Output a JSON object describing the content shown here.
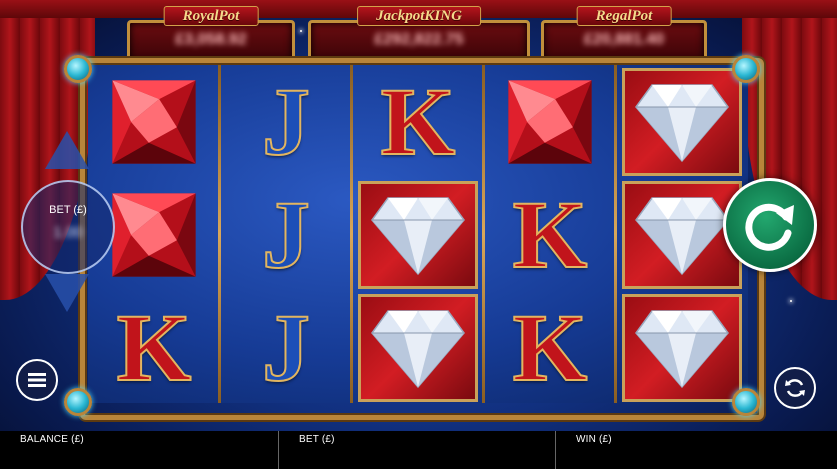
{
  "jackpots": [
    {
      "name": "RoyalPot",
      "value": "£3,058.92"
    },
    {
      "name": "JackpotKING",
      "value": "£292,822.75"
    },
    {
      "name": "RegalPot",
      "value": "£20,881.40"
    }
  ],
  "reels": [
    [
      "red-gem",
      "red-gem",
      "K"
    ],
    [
      "J",
      "J",
      "J"
    ],
    [
      "K",
      "diamond",
      "diamond"
    ],
    [
      "red-gem",
      "K",
      "K"
    ],
    [
      "diamond",
      "diamond",
      "diamond"
    ]
  ],
  "bet_control": {
    "label": "BET (£)",
    "amount": "1.00"
  },
  "icons": {
    "menu": "hamburger-menu-icon",
    "spin": "spin-arrow-icon",
    "autoplay": "autoplay-cycle-icon",
    "bet_up": "triangle-up-icon",
    "bet_down": "triangle-down-icon"
  },
  "status_bar": {
    "balance_label": "BALANCE (£)",
    "bet_label": "BET (£)",
    "win_label": "WIN (£)"
  },
  "colors": {
    "spin_button": "#0b6e44",
    "frame_gold": "#b9853a",
    "curtain_red": "#b0151b",
    "king_letter": "#c1141b",
    "jack_letter": "#1c4fb8"
  }
}
